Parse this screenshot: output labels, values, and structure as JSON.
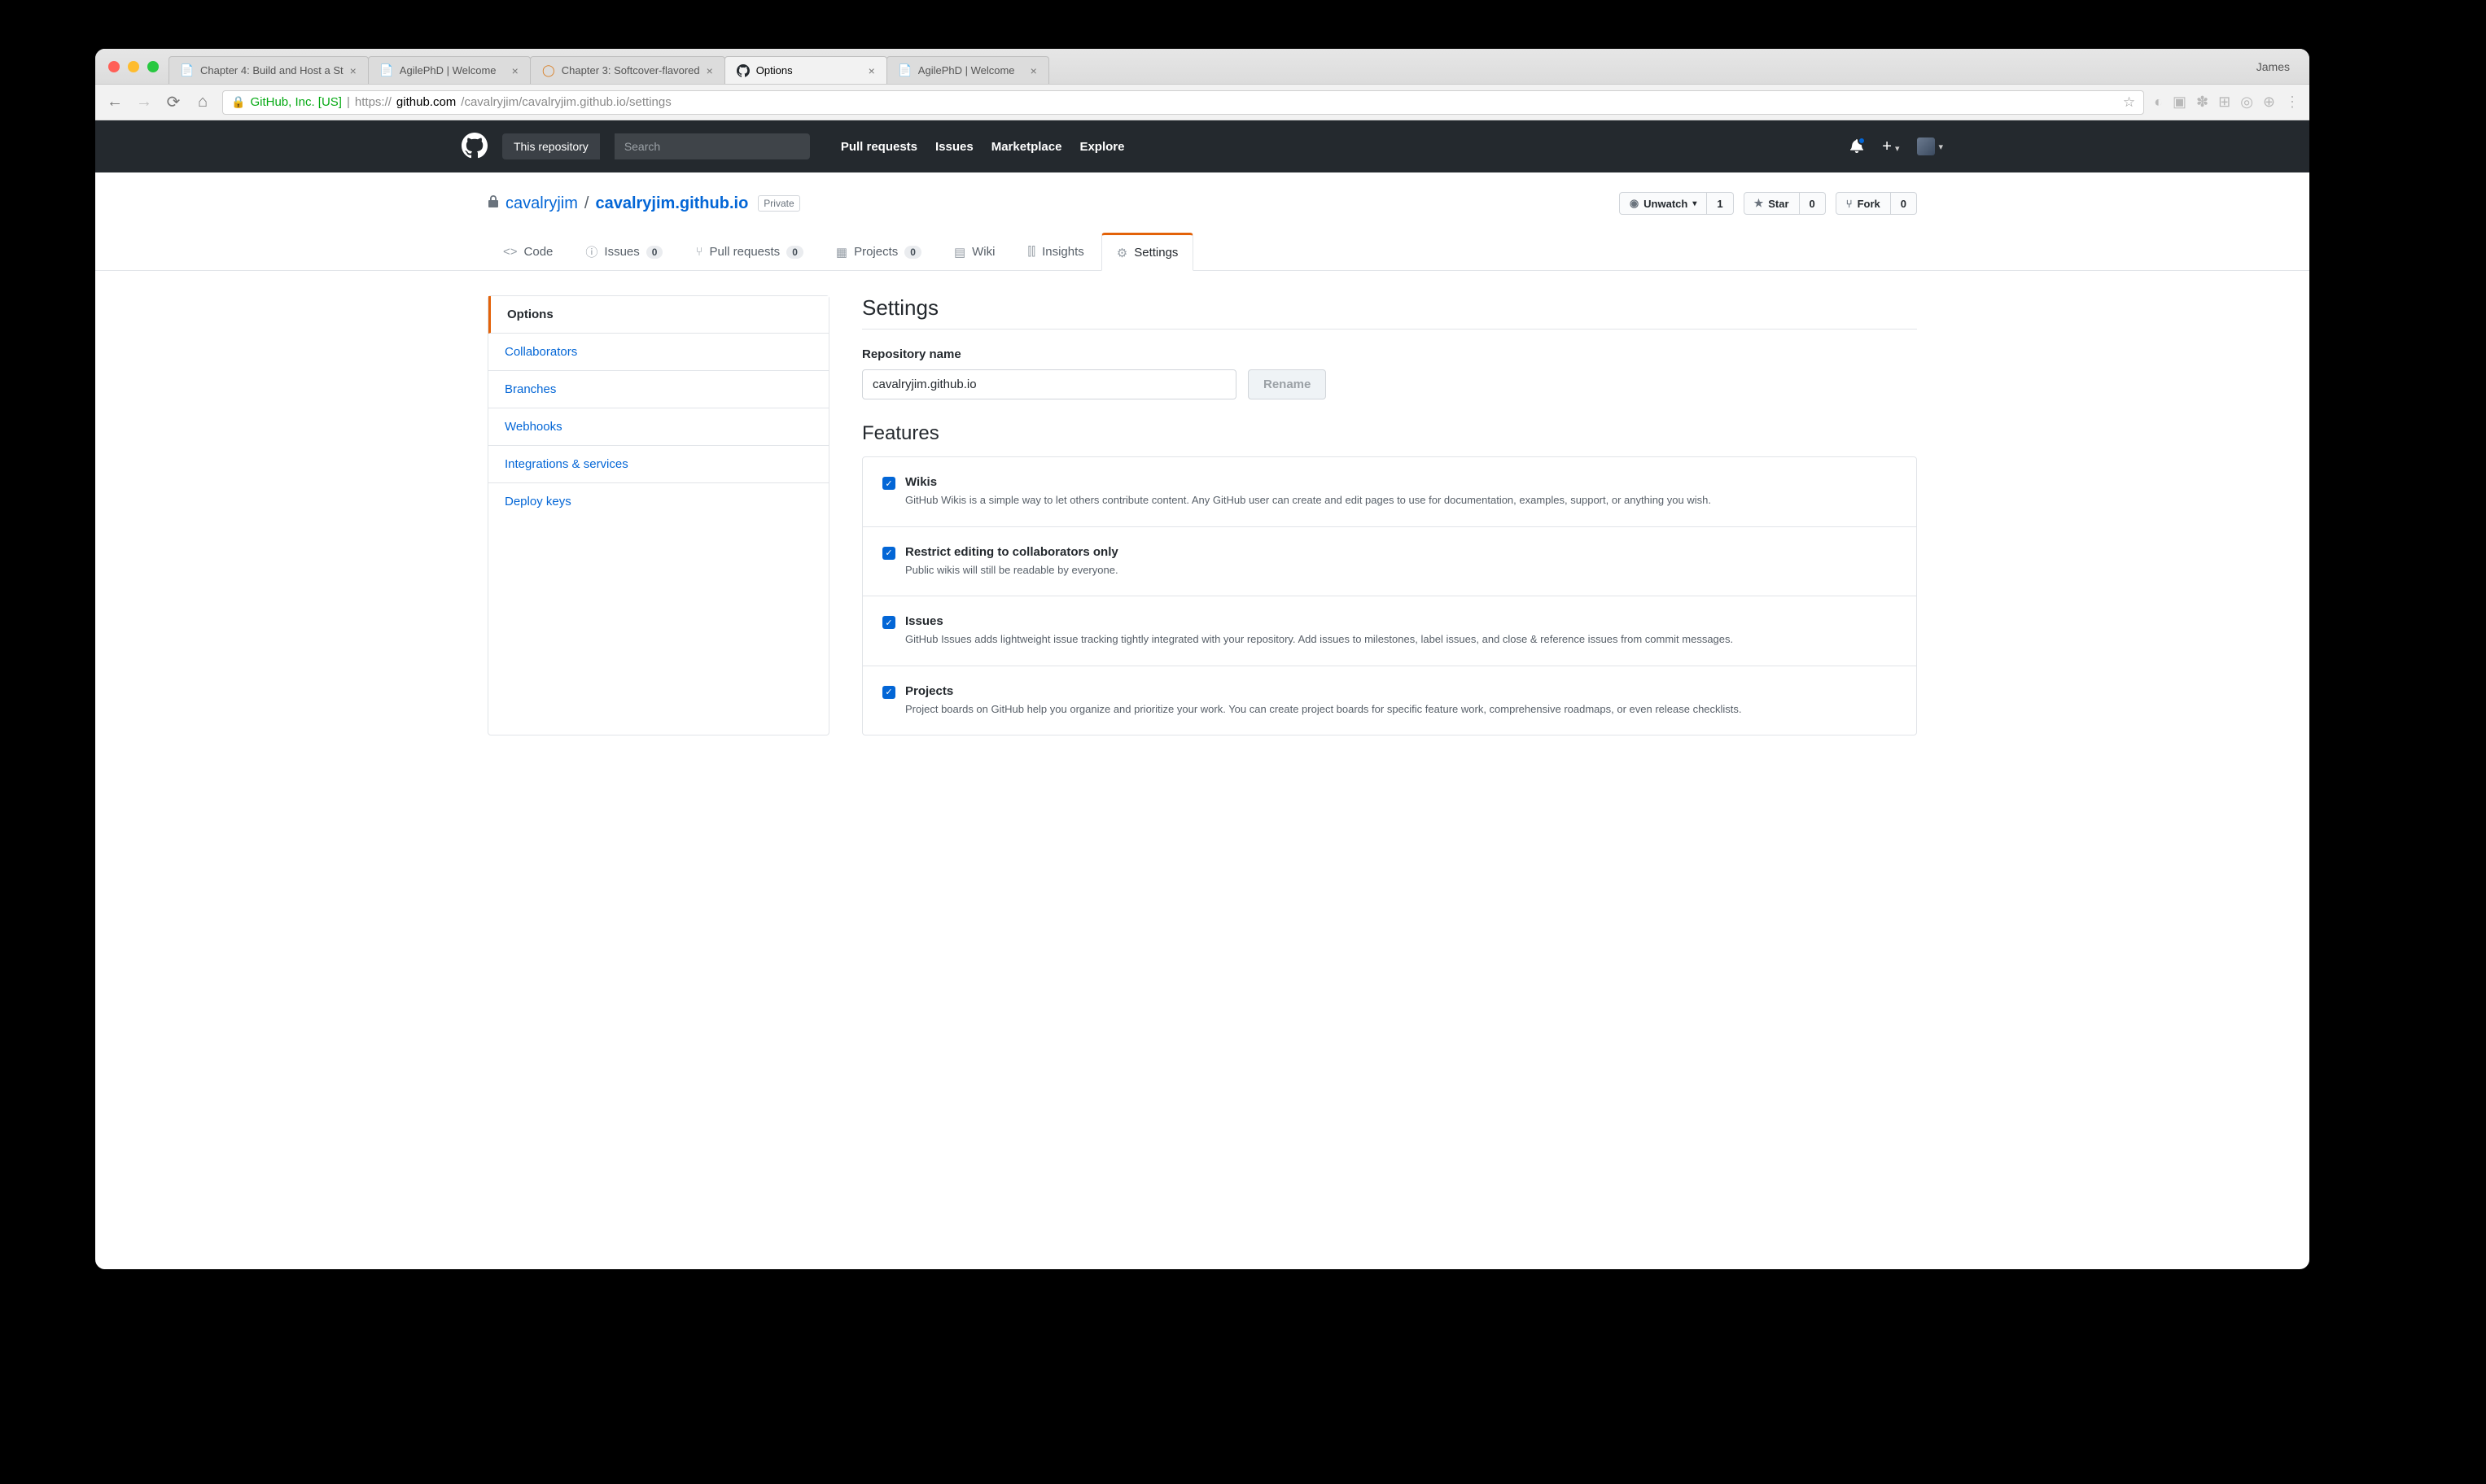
{
  "browser": {
    "profile_name": "James",
    "tabs": [
      {
        "title": "Chapter 4: Build and Host a St",
        "active": false,
        "favicon": "doc"
      },
      {
        "title": "AgilePhD | Welcome",
        "active": false,
        "favicon": "doc"
      },
      {
        "title": "Chapter 3: Softcover-flavored",
        "active": false,
        "favicon": "soft"
      },
      {
        "title": "Options",
        "active": true,
        "favicon": "gh"
      },
      {
        "title": "AgilePhD | Welcome",
        "active": false,
        "favicon": "doc"
      }
    ],
    "omnibox": {
      "org": "GitHub, Inc. [US]",
      "prefix": "https://",
      "host": "github.com",
      "path": "/cavalryjim/cavalryjim.github.io/settings"
    }
  },
  "github": {
    "search_scope": "This repository",
    "search_placeholder": "Search",
    "nav": [
      "Pull requests",
      "Issues",
      "Marketplace",
      "Explore"
    ]
  },
  "repo": {
    "owner": "cavalryjim",
    "name": "cavalryjim.github.io",
    "private_label": "Private",
    "actions": {
      "watch_label": "Unwatch",
      "watch_count": "1",
      "star_label": "Star",
      "star_count": "0",
      "fork_label": "Fork",
      "fork_count": "0"
    },
    "tabs": {
      "code": "Code",
      "issues": "Issues",
      "issues_count": "0",
      "prs": "Pull requests",
      "prs_count": "0",
      "projects": "Projects",
      "projects_count": "0",
      "wiki": "Wiki",
      "insights": "Insights",
      "settings": "Settings"
    }
  },
  "settings": {
    "menu": [
      "Options",
      "Collaborators",
      "Branches",
      "Webhooks",
      "Integrations & services",
      "Deploy keys"
    ],
    "menu_selected": "Options",
    "heading": "Settings",
    "repo_name_label": "Repository name",
    "repo_name_value": "cavalryjim.github.io",
    "rename_button": "Rename",
    "features_heading": "Features",
    "features": [
      {
        "title": "Wikis",
        "desc": "GitHub Wikis is a simple way to let others contribute content. Any GitHub user can create and edit pages to use for documentation, examples, support, or anything you wish.",
        "checked": true
      },
      {
        "title": "Restrict editing to collaborators only",
        "desc": "Public wikis will still be readable by everyone.",
        "checked": true
      },
      {
        "title": "Issues",
        "desc": "GitHub Issues adds lightweight issue tracking tightly integrated with your repository. Add issues to milestones, label issues, and close & reference issues from commit messages.",
        "checked": true
      },
      {
        "title": "Projects",
        "desc": "Project boards on GitHub help you organize and prioritize your work. You can create project boards for specific feature work, comprehensive roadmaps, or even release checklists.",
        "checked": true
      }
    ]
  }
}
